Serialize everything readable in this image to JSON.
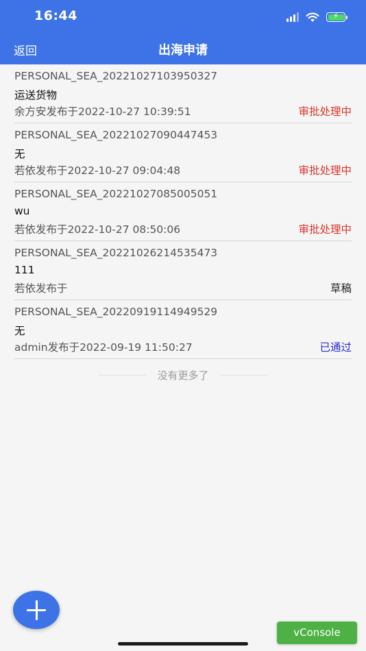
{
  "status_bar": {
    "time": "16:44",
    "icons": [
      "cellular-signal-icon",
      "wifi-icon",
      "battery-charging-icon"
    ]
  },
  "nav": {
    "back_label": "返回",
    "title": "出海申请"
  },
  "items": [
    {
      "code": "PERSONAL_SEA_20221027103950327",
      "subject": "运送货物",
      "meta": "余方安发布于2022-10-27 10:39:51",
      "status": "审批处理中",
      "status_color": "#d9342b"
    },
    {
      "code": "PERSONAL_SEA_20221027090447453",
      "subject": "无",
      "meta": "若依发布于2022-10-27 09:04:48",
      "status": "审批处理中",
      "status_color": "#d9342b"
    },
    {
      "code": "PERSONAL_SEA_20221027085005051",
      "subject": "wu",
      "meta": "若依发布于2022-10-27 08:50:06",
      "status": "审批处理中",
      "status_color": "#d9342b"
    },
    {
      "code": "PERSONAL_SEA_20221026214535473",
      "subject": "111",
      "meta": "若依发布于",
      "status": "草稿",
      "status_color": "#222222"
    },
    {
      "code": "PERSONAL_SEA_20220919114949529",
      "subject": "无",
      "meta": "admin发布于2022-09-19 11:50:27",
      "status": "已通过",
      "status_color": "#2a2ad0"
    }
  ],
  "footer": {
    "no_more_text": "没有更多了"
  },
  "fab": {
    "icon": "plus-icon"
  },
  "vconsole": {
    "label": "vConsole"
  },
  "colors": {
    "primary": "#3d73e6",
    "pending": "#d9342b",
    "approved": "#2a2ad0",
    "vconsole": "#4eb146"
  }
}
